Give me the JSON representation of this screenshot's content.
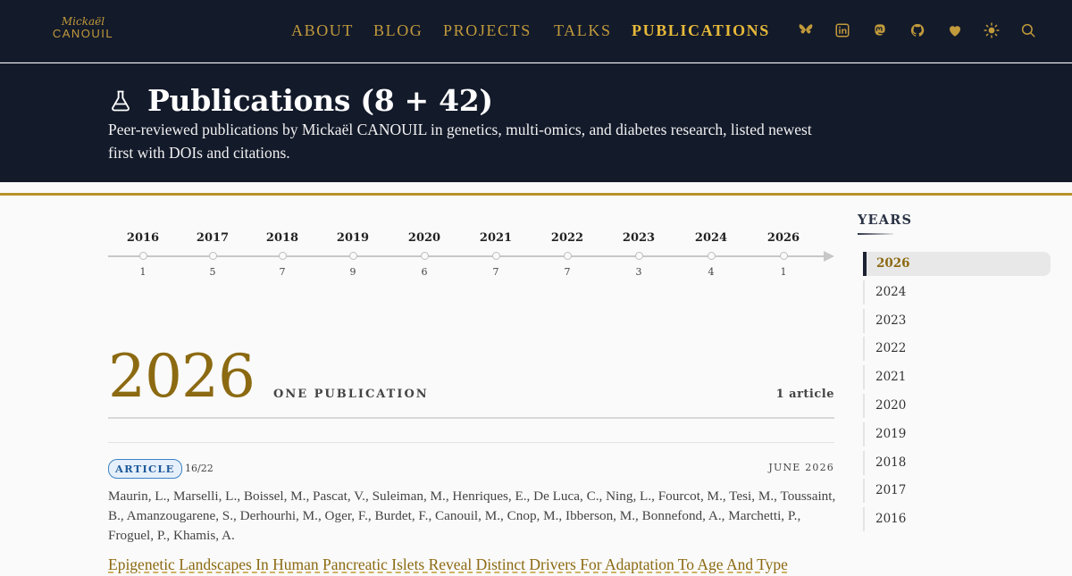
{
  "brand": {
    "script": "Mickaël",
    "caps": "CANOUIL"
  },
  "nav": {
    "links": [
      {
        "label": "ABOUT",
        "active": false
      },
      {
        "label": "BLOG",
        "active": false
      },
      {
        "label": "PROJECTS",
        "active": false
      },
      {
        "label": "TALKS",
        "active": false
      },
      {
        "label": "PUBLICATIONS",
        "active": true
      }
    ],
    "icons": [
      "bluesky-icon",
      "linkedin-icon",
      "mastodon-icon",
      "github-icon",
      "heart-icon",
      "sun-icon",
      "search-icon"
    ]
  },
  "header": {
    "title": "Publications (8 + 42)",
    "description": "Peer-reviewed publications by Mickaël CANOUIL in genetics, multi-omics, and diabetes research, listed newest first with DOIs and citations."
  },
  "timeline": {
    "years": [
      "2016",
      "2017",
      "2018",
      "2019",
      "2020",
      "2021",
      "2022",
      "2023",
      "2024",
      "2026"
    ],
    "counts": [
      "1",
      "5",
      "7",
      "9",
      "6",
      "7",
      "7",
      "3",
      "4",
      "1"
    ]
  },
  "section": {
    "year": "2026",
    "subtitle": "ONE PUBLICATION",
    "count": "1 article"
  },
  "publication": {
    "badge": "ARTICLE",
    "id": "16/22",
    "date": "JUNE 2026",
    "authors": "Maurin, L., Marselli, L., Boissel, M., Pascat, V., Suleiman, M., Henriques, E., De Luca, C., Ning, L., Fourcot, M., Tesi, M., Toussaint, B., Amanzougarene, S., Derhourhi, M., Oger, F., Burdet, F., Canouil, M., Cnop, M., Ibberson, M., Bonnefond, A., Marchetti, P., Froguel, P., Khamis, A.",
    "title": "Epigenetic Landscapes In Human Pancreatic Islets Reveal Distinct Drivers For Adaptation To Age And Type"
  },
  "sidebar": {
    "title": "YEARS",
    "years": [
      "2026",
      "2024",
      "2023",
      "2022",
      "2021",
      "2020",
      "2019",
      "2018",
      "2017",
      "2016"
    ],
    "active": "2026"
  },
  "colors": {
    "navy": "#131a2a",
    "gold": "#c19a3b",
    "gold_dark": "#8c6a12",
    "badge_blue": "#3b82c4"
  }
}
